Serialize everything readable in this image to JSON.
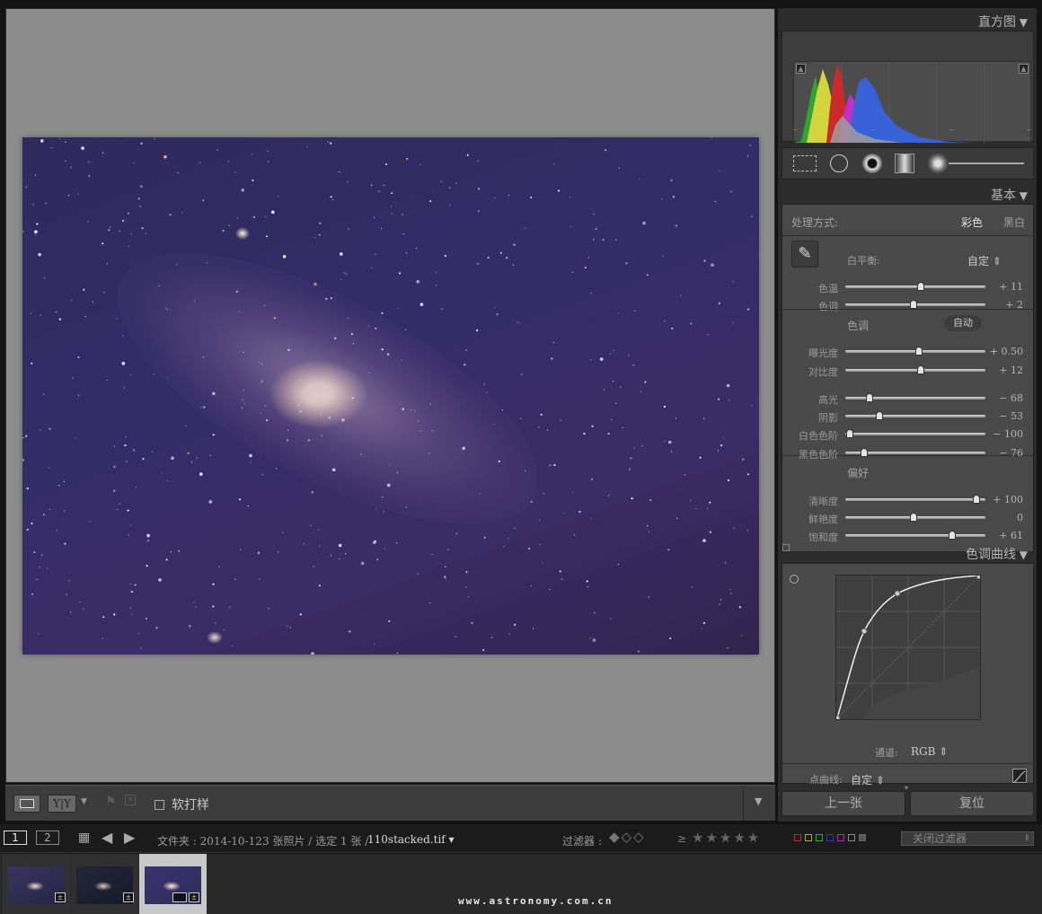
{
  "toolbar": {
    "softproof_label": "软打样"
  },
  "panel": {
    "histogram_title": "直方图",
    "basic_title": "基本",
    "treatment_label": "处理方式:",
    "treatment_color": "彩色",
    "treatment_bw": "黑白",
    "wb_label": "白平衡:",
    "wb_value": "自定 ⇕",
    "temp": {
      "label": "色温",
      "value": "+ 11",
      "pos": 0.55
    },
    "tint": {
      "label": "色调",
      "value": "+ 2",
      "pos": 0.5
    },
    "tone_title": "色调",
    "auto_label": "自动",
    "exposure": {
      "label": "曝光度",
      "value": "+ 0.50",
      "pos": 0.54
    },
    "contrast": {
      "label": "对比度",
      "value": "+ 12",
      "pos": 0.55
    },
    "highlights": {
      "label": "高光",
      "value": "− 68",
      "pos": 0.18
    },
    "shadows": {
      "label": "阴影",
      "value": "− 53",
      "pos": 0.25
    },
    "whites": {
      "label": "白色色阶",
      "value": "− 100",
      "pos": 0.03
    },
    "blacks": {
      "label": "黑色色阶",
      "value": "− 76",
      "pos": 0.14
    },
    "presence_title": "偏好",
    "clarity": {
      "label": "清晰度",
      "value": "+ 100",
      "pos": 0.96
    },
    "vibrance": {
      "label": "鲜艳度",
      "value": "0",
      "pos": 0.5
    },
    "saturation": {
      "label": "饱和度",
      "value": "+ 61",
      "pos": 0.78
    },
    "curve_title": "色调曲线",
    "channel_label": "通道:",
    "channel_value": "RGB ⇕",
    "pointcurve_label": "点曲线:",
    "pointcurve_value": "自定 ⇕",
    "prev_button": "上一张",
    "reset_button": "复位"
  },
  "filmstrip": {
    "view1": "1",
    "view2": "2",
    "folder_info": "文件夹 : 2014-10-12",
    "count_info": "3 张照片 / 选定 1 张 /",
    "filename": "110stacked.tif ▾",
    "filter_label": "过滤器 :",
    "rating_op": "≥",
    "filter_select": "关闭过滤器"
  },
  "watermark": "www.astronomy.com.cn"
}
